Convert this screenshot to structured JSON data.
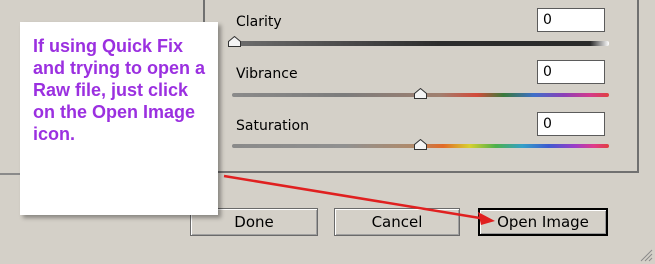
{
  "adjustments": {
    "clarity": {
      "label": "Clarity",
      "value": "0"
    },
    "vibrance": {
      "label": "Vibrance",
      "value": "0"
    },
    "saturation": {
      "label": "Saturation",
      "value": "0"
    }
  },
  "buttons": {
    "done": "Done",
    "cancel": "Cancel",
    "open_image": "Open Image"
  },
  "callout": {
    "text": "If using Quick Fix and trying to open a Raw file, just click on the Open Image icon."
  },
  "colors": {
    "callout_text": "#9b30e0",
    "arrow": "#e02020",
    "background": "#d4d0c8"
  }
}
